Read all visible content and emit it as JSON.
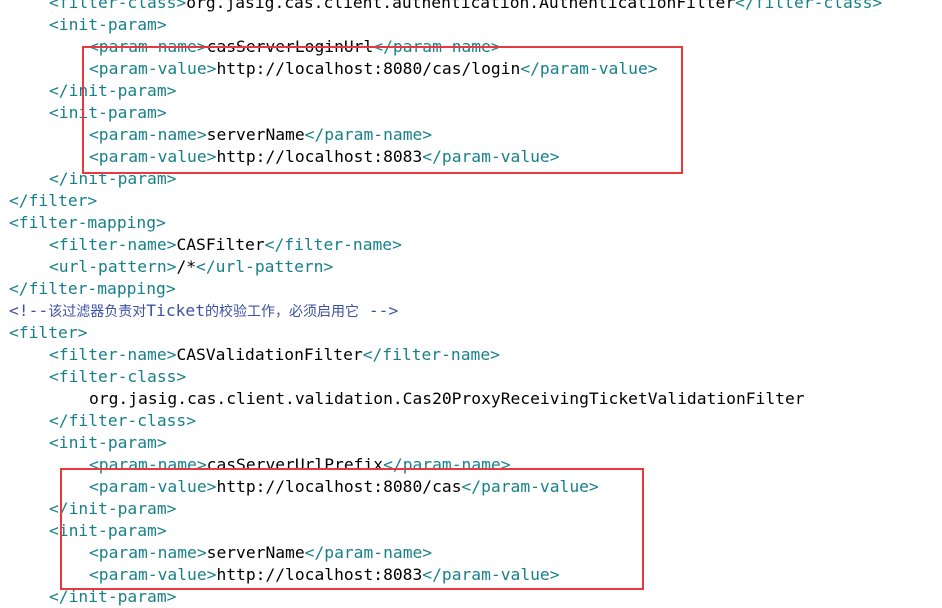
{
  "colors": {
    "tag": "#17808a",
    "text": "#000000",
    "comment": "#3d52a3",
    "highlight_border": "#e8393f",
    "background": "#ffffff"
  },
  "lines": [
    {
      "indent": 1,
      "kind": "elem",
      "open": "<filter-class>",
      "text": "org.jasig.cas.client.authentication.AuthenticationFilter",
      "close": "</filter-class>"
    },
    {
      "indent": 1,
      "kind": "tag",
      "tag": "<init-param>"
    },
    {
      "indent": 2,
      "kind": "elem",
      "open": "<param-name>",
      "text": "casServerLoginUrl",
      "close": "</param-name>"
    },
    {
      "indent": 2,
      "kind": "elem",
      "open": "<param-value>",
      "text": "http://localhost:8080/cas/login",
      "close": "</param-value>"
    },
    {
      "indent": 1,
      "kind": "tag",
      "tag": "</init-param>"
    },
    {
      "indent": 1,
      "kind": "tag",
      "tag": "<init-param>"
    },
    {
      "indent": 2,
      "kind": "elem",
      "open": "<param-name>",
      "text": "serverName",
      "close": "</param-name>"
    },
    {
      "indent": 2,
      "kind": "elem",
      "open": "<param-value>",
      "text": "http://localhost:8083",
      "close": "</param-value>"
    },
    {
      "indent": 1,
      "kind": "tag",
      "tag": "</init-param>"
    },
    {
      "indent": 0,
      "kind": "tag",
      "tag": "</filter>"
    },
    {
      "indent": 0,
      "kind": "tag",
      "tag": "<filter-mapping>"
    },
    {
      "indent": 1,
      "kind": "elem",
      "open": "<filter-name>",
      "text": "CASFilter",
      "close": "</filter-name>"
    },
    {
      "indent": 1,
      "kind": "elem",
      "open": "<url-pattern>",
      "text": "/*",
      "close": "</url-pattern>"
    },
    {
      "indent": 0,
      "kind": "tag",
      "tag": "</filter-mapping>"
    },
    {
      "indent": 0,
      "kind": "comment",
      "parts": [
        {
          "t": "<!--",
          "cjk": false
        },
        {
          "t": "该过滤器负责对",
          "cjk": true
        },
        {
          "t": "Ticket",
          "cjk": false
        },
        {
          "t": "的校验工作，必须启用它",
          "cjk": true
        },
        {
          "t": " -->",
          "cjk": false
        }
      ]
    },
    {
      "indent": 0,
      "kind": "tag",
      "tag": "<filter>"
    },
    {
      "indent": 1,
      "kind": "elem",
      "open": "<filter-name>",
      "text": "CASValidationFilter",
      "close": "</filter-name>"
    },
    {
      "indent": 1,
      "kind": "tag",
      "tag": "<filter-class>"
    },
    {
      "indent": 2,
      "kind": "text",
      "text": "org.jasig.cas.client.validation.Cas20ProxyReceivingTicketValidationFilter"
    },
    {
      "indent": 1,
      "kind": "tag",
      "tag": "</filter-class>"
    },
    {
      "indent": 1,
      "kind": "tag",
      "tag": "<init-param>"
    },
    {
      "indent": 2,
      "kind": "elem",
      "open": "<param-name>",
      "text": "casServerUrlPrefix",
      "close": "</param-name>"
    },
    {
      "indent": 2,
      "kind": "elem",
      "open": "<param-value>",
      "text": "http://localhost:8080/cas",
      "close": "</param-value>"
    },
    {
      "indent": 1,
      "kind": "tag",
      "tag": "</init-param>"
    },
    {
      "indent": 1,
      "kind": "tag",
      "tag": "<init-param>"
    },
    {
      "indent": 2,
      "kind": "elem",
      "open": "<param-name>",
      "text": "serverName",
      "close": "</param-name>"
    },
    {
      "indent": 2,
      "kind": "elem",
      "open": "<param-value>",
      "text": "http://localhost:8083",
      "close": "</param-value>"
    },
    {
      "indent": 1,
      "kind": "tag",
      "tag": "</init-param>"
    }
  ],
  "highlights": [
    {
      "from_line": 2,
      "to_line": 8
    },
    {
      "from_line": 22,
      "to_line": 27
    }
  ]
}
